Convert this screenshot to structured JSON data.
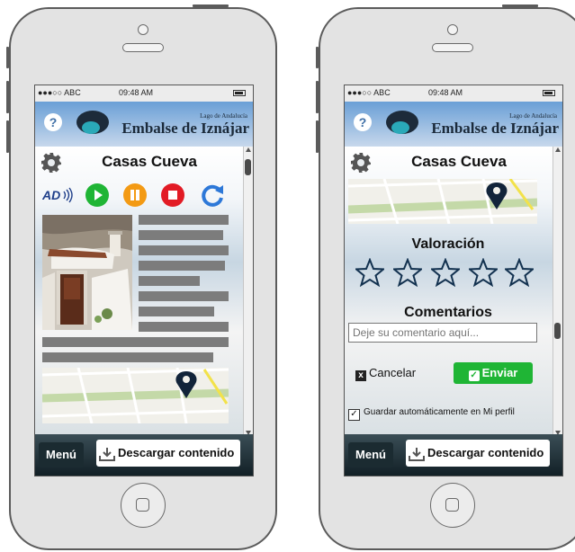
{
  "status_bar": {
    "carrier": "●●●○○ ABC",
    "time": "09:48 AM"
  },
  "header": {
    "logo_small": "Lago de Andalucía",
    "logo_big": "Embalse de Iznájar",
    "help": "?"
  },
  "left_screen": {
    "title": "Casas Cueva"
  },
  "right_screen": {
    "title": "Casas Cueva",
    "rating_heading": "Valoración",
    "rating_stars": 5,
    "comments_heading": "Comentarios",
    "comment_placeholder": "Deje su comentario aquí...",
    "cancel_label": "Cancelar",
    "send_label": "Enviar",
    "autosave_label": "Guardar automáticamente en Mi perfil",
    "autosave_checked": true
  },
  "footer": {
    "menu_label": "Menú",
    "download_label": "Descargar contenido"
  },
  "colors": {
    "play": "#1fb535",
    "pause": "#f39a14",
    "stop": "#e21b25",
    "refresh": "#2d78d8",
    "header": "#6a9fd6",
    "send": "#1fb535"
  },
  "icons": [
    "help-icon",
    "gear-icon",
    "audio-description-icon",
    "play-icon",
    "pause-icon",
    "stop-icon",
    "refresh-icon",
    "map-pin-icon",
    "star-icon",
    "download-icon",
    "checkbox-icon"
  ]
}
